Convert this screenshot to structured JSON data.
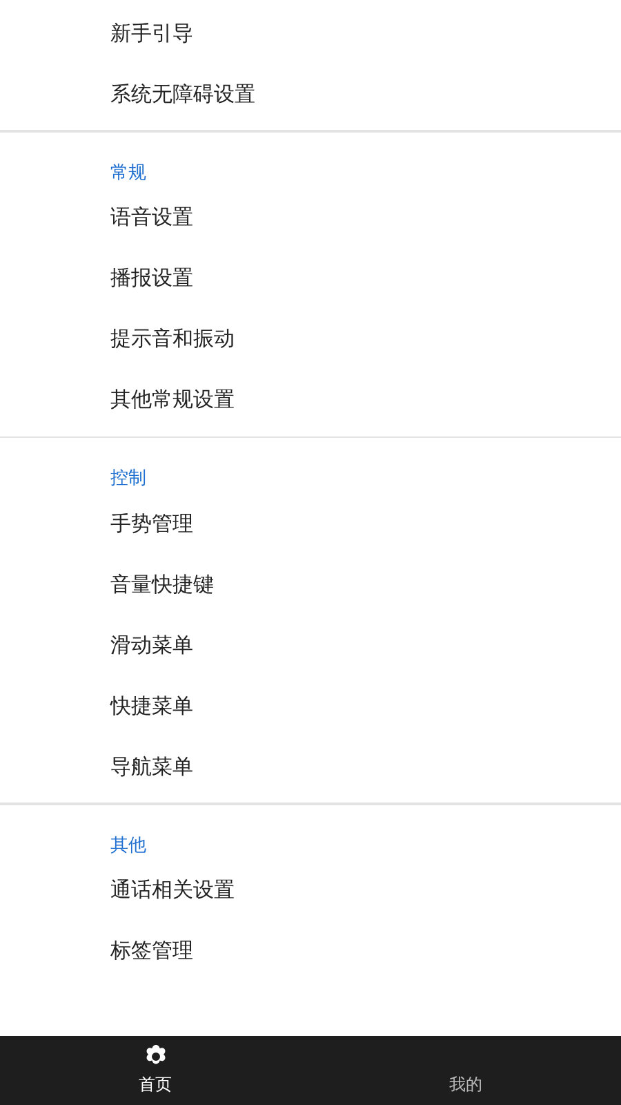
{
  "sections": [
    {
      "items": [
        "新手引导",
        "系统无障碍设置"
      ]
    },
    {
      "header": "常规",
      "items": [
        "语音设置",
        "播报设置",
        "提示音和振动",
        "其他常规设置"
      ]
    },
    {
      "header": "控制",
      "items": [
        "手势管理",
        "音量快捷键",
        "滑动菜单",
        "快捷菜单",
        "导航菜单"
      ]
    },
    {
      "header": "其他",
      "items": [
        "通话相关设置",
        "标签管理"
      ]
    }
  ],
  "bottom_nav": [
    {
      "label": "首页",
      "selected": true
    },
    {
      "label": "我的",
      "selected": false
    }
  ]
}
